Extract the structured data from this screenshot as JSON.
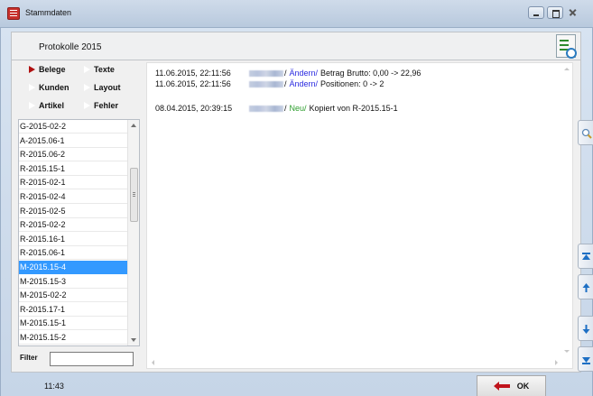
{
  "window": {
    "title": "Stammdaten",
    "buttons": [
      "minimize",
      "maximize",
      "close"
    ]
  },
  "header": {
    "title": "Protokolle 2015",
    "icon": "checklist-clock-icon"
  },
  "categories": [
    {
      "label": "Belege",
      "active": true
    },
    {
      "label": "Texte",
      "active": false
    },
    {
      "label": "Kunden",
      "active": false
    },
    {
      "label": "Layout",
      "active": false
    },
    {
      "label": "Artikel",
      "active": false
    },
    {
      "label": "Fehler",
      "active": false
    }
  ],
  "codes": {
    "selected": "M-2015.15-4",
    "items": [
      "G-2015-02-2",
      "A-2015.06-1",
      "R-2015.06-2",
      "R-2015.15-1",
      "R-2015-02-1",
      "R-2015-02-4",
      "R-2015-02-5",
      "R-2015-02-2",
      "R-2015.16-1",
      "R-2015.06-1",
      "M-2015.15-4",
      "M-2015.15-3",
      "M-2015-02-2",
      "R-2015.17-1",
      "M-2015.15-1",
      "M-2015.15-2"
    ]
  },
  "filter": {
    "label": "Filter",
    "value": ""
  },
  "log": {
    "entries": [
      {
        "date": "11.06.2015, 22:11:56",
        "user_hidden": true,
        "action": "Ändern/",
        "action_type": "changed",
        "text": "Betrag Brutto:  0,00 -> 22,96"
      },
      {
        "date": "11.06.2015, 22:11:56",
        "user_hidden": true,
        "action": "Ändern/",
        "action_type": "changed",
        "text": "Positionen:  0 -> 2"
      },
      {
        "date": "08.04.2015, 20:39:15",
        "user_hidden": true,
        "action": "Neu/",
        "action_type": "new",
        "text": "Kopiert von R-2015.15-1"
      }
    ]
  },
  "side_buttons": [
    "search-icon",
    "first-icon",
    "up-icon",
    "down-icon",
    "last-icon"
  ],
  "footer": {
    "time": "11:43",
    "ok_label": "OK",
    "ok_icon": "arrow-left-icon"
  },
  "colors": {
    "accent": "#3399ff",
    "changed": "#2a2ae0",
    "new": "#2e9e2e",
    "arrow_red": "#c0141c",
    "side_arrow_blue": "#1d6fc4"
  }
}
